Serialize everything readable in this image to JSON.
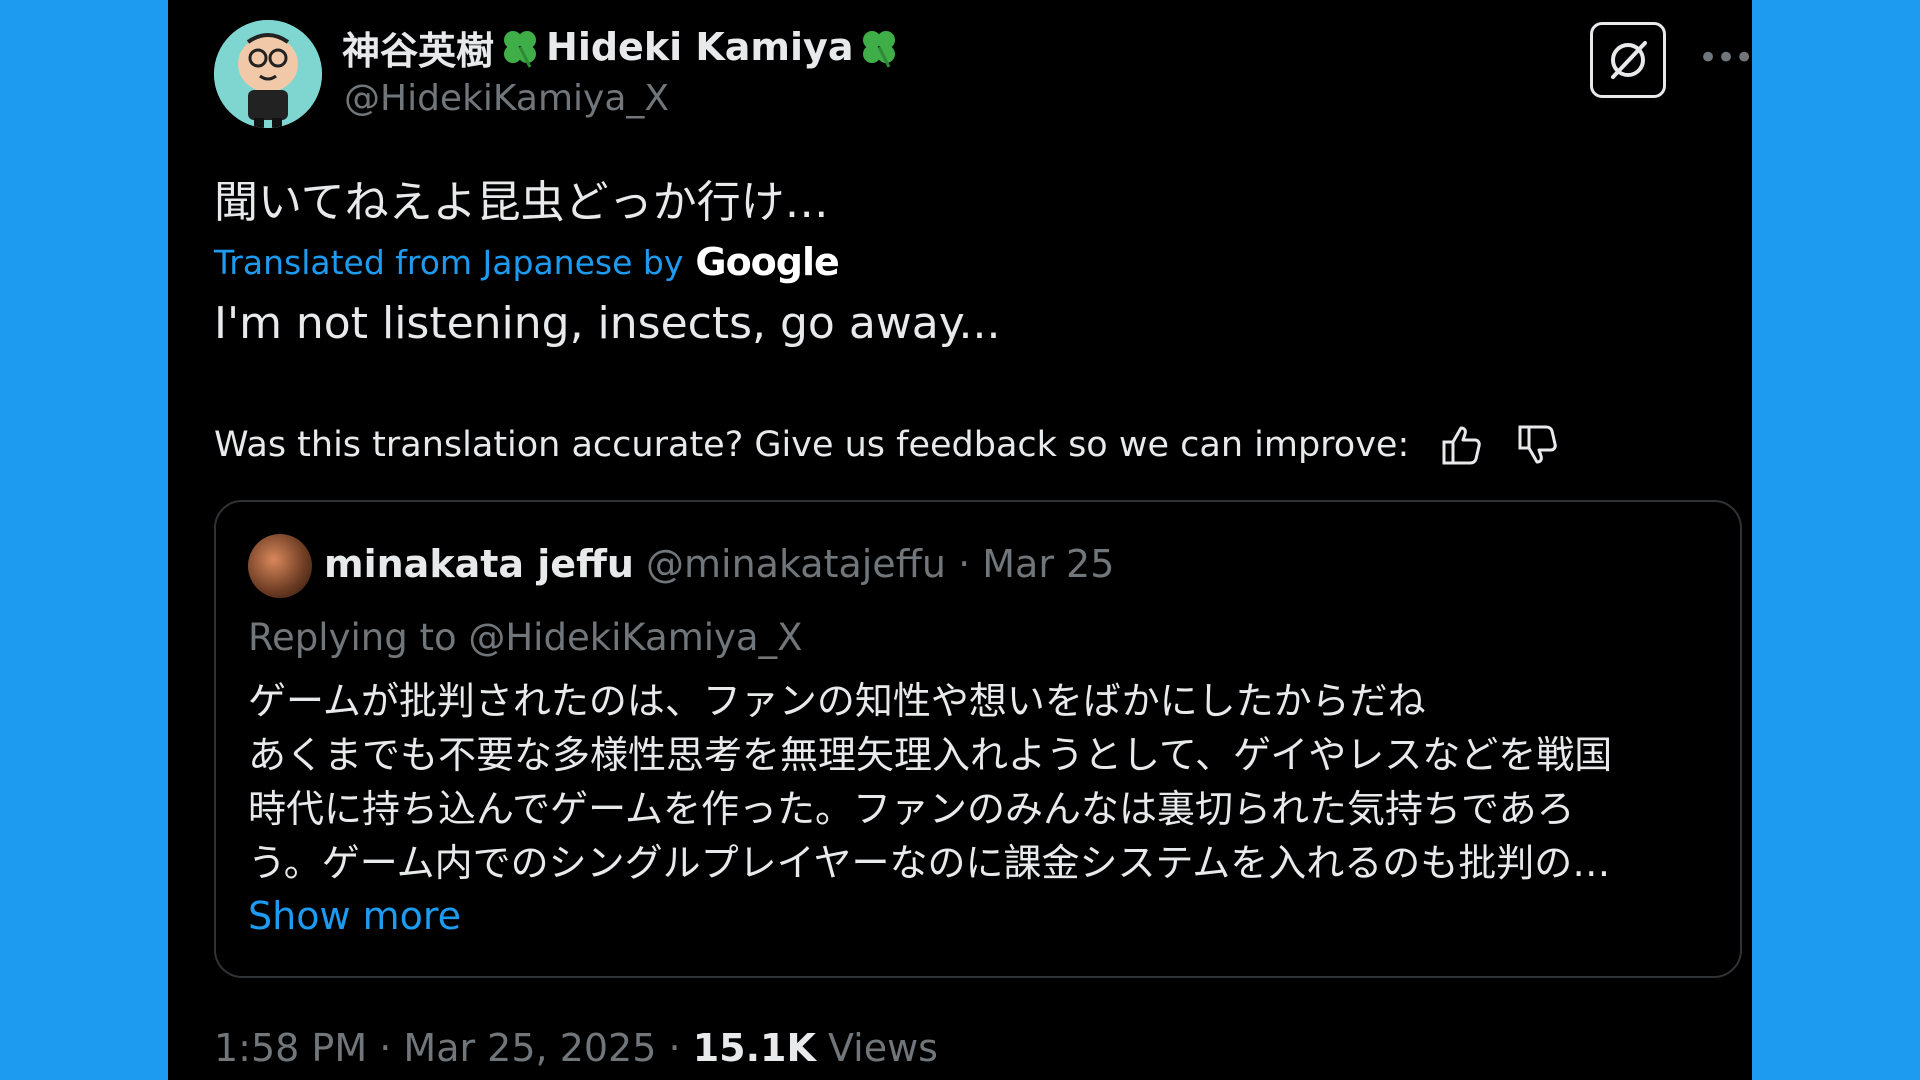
{
  "author": {
    "display_name": "神谷英樹",
    "display_name_latin": "Hideki Kamiya",
    "handle": "@HidekiKamiya_X"
  },
  "tweet": {
    "original_text": "聞いてねえよ昆虫どっか行け…",
    "translated_label": "Translated from Japanese by",
    "translator": "Google",
    "translation": "I'm not listening, insects, go away...",
    "feedback_prompt": "Was this translation accurate? Give us feedback so we can improve:"
  },
  "quote": {
    "name": "minakata jeffu",
    "handle": "@minakatajeffu",
    "separator": "·",
    "date": "Mar 25",
    "replying_to": "Replying to @HidekiKamiya_X",
    "body_lines": [
      "ゲームが批判されたのは、ファンの知性や想いをばかにしたからだね",
      "あくまでも不要な多様性思考を無理矢理入れようとして、ゲイやレスなどを戦国",
      "時代に持ち込んでゲームを作った。ファンのみんなは裏切られた気持ちであろ",
      "う。ゲーム内でのシングルプレイヤーなのに課金システムを入れるのも批判の…"
    ],
    "show_more": "Show more"
  },
  "footer": {
    "time": "1:58 PM",
    "date": "Mar 25, 2025",
    "separator": "·",
    "views_count": "15.1K",
    "views_label": "Views"
  },
  "icons": {
    "clover": "four-leaf-clover-icon",
    "grok": "grok-icon",
    "more": "more-icon",
    "thumbs_up": "thumbs-up-icon",
    "thumbs_down": "thumbs-down-icon"
  },
  "colors": {
    "page_background": "#1d9bf0",
    "panel_background": "#000000",
    "accent": "#1d9bf0",
    "secondary_text": "#71767b",
    "clover_green": "#3fae49"
  }
}
